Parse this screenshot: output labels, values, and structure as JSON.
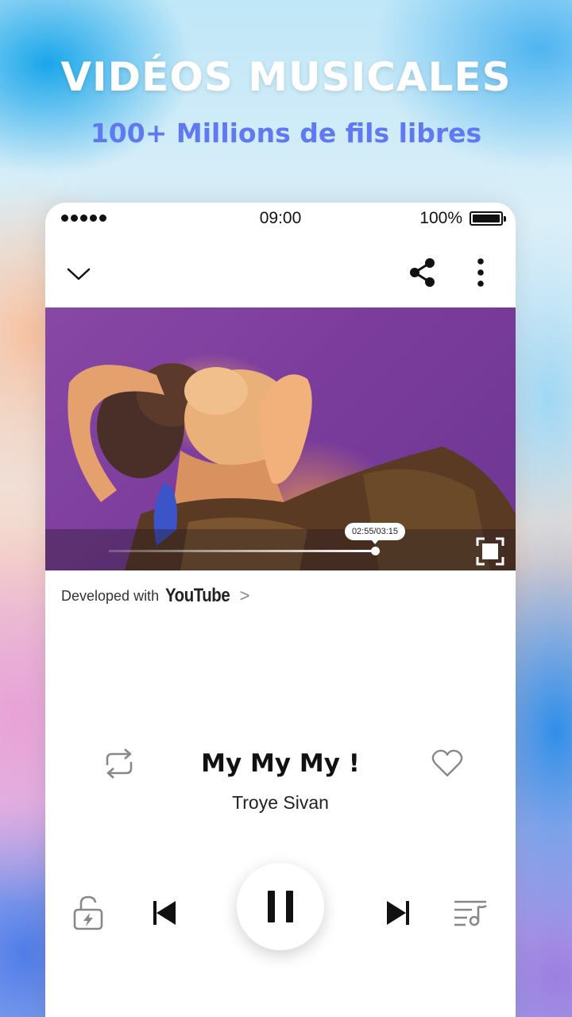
{
  "promo": {
    "title": "VIDÉOS MUSICALES",
    "subtitle": "100+ Millions de fils libres"
  },
  "status_bar": {
    "time": "09:00",
    "battery_percent": "100%"
  },
  "top_bar": {
    "icons": [
      "chevron-down-icon",
      "share-icon",
      "more-vertical-icon"
    ]
  },
  "video": {
    "time_label": "02:55/03:15",
    "progress_fraction": 0.9,
    "tint_color": "#7b3c9b"
  },
  "developed_row": {
    "text": "Developed with",
    "brand": "YouTube",
    "chevron": ">"
  },
  "track": {
    "title": "My My My !",
    "artist": "Troye Sivan",
    "liked": false
  },
  "controls": {
    "icons": [
      "repeat-icon",
      "heart-icon",
      "lock-icon",
      "previous-icon",
      "pause-icon",
      "next-icon",
      "playlist-icon"
    ]
  },
  "colors": {
    "accent_blue": "#6079f2",
    "title_white": "#ffffff"
  }
}
